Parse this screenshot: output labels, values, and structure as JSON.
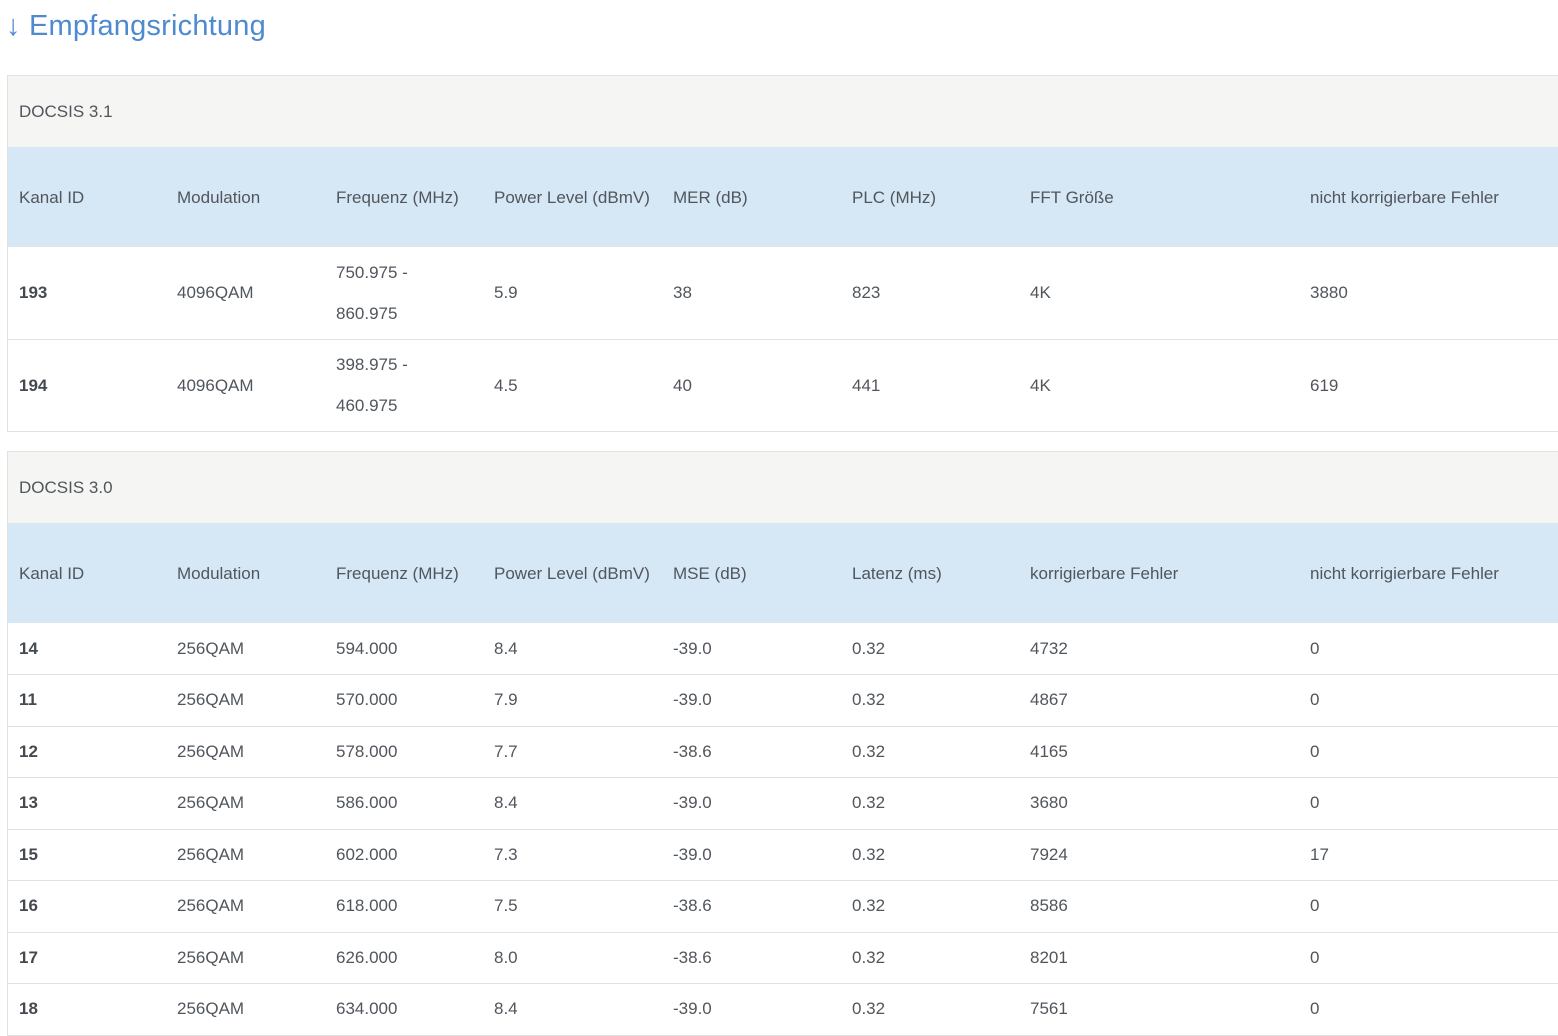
{
  "heading": "↓ Empfangsrichtung",
  "docsis31": {
    "title": "DOCSIS 3.1",
    "headers": [
      "Kanal ID",
      "Modulation",
      "Frequenz (MHz)",
      "Power Level (dBmV)",
      "MER (dB)",
      "PLC (MHz)",
      "FFT Größe",
      "nicht korrigierbare Fehler"
    ],
    "rows": [
      [
        "193",
        "4096QAM",
        "750.975 - 860.975",
        "5.9",
        "38",
        "823",
        "4K",
        "3880"
      ],
      [
        "194",
        "4096QAM",
        "398.975 - 460.975",
        "4.5",
        "40",
        "441",
        "4K",
        "619"
      ]
    ]
  },
  "docsis30": {
    "title": "DOCSIS 3.0",
    "headers": [
      "Kanal ID",
      "Modulation",
      "Frequenz (MHz)",
      "Power Level (dBmV)",
      "MSE (dB)",
      "Latenz (ms)",
      "korrigierbare Fehler",
      "nicht korrigierbare Fehler"
    ],
    "rows": [
      [
        "14",
        "256QAM",
        "594.000",
        "8.4",
        "-39.0",
        "0.32",
        "4732",
        "0"
      ],
      [
        "11",
        "256QAM",
        "570.000",
        "7.9",
        "-39.0",
        "0.32",
        "4867",
        "0"
      ],
      [
        "12",
        "256QAM",
        "578.000",
        "7.7",
        "-38.6",
        "0.32",
        "4165",
        "0"
      ],
      [
        "13",
        "256QAM",
        "586.000",
        "8.4",
        "-39.0",
        "0.32",
        "3680",
        "0"
      ],
      [
        "15",
        "256QAM",
        "602.000",
        "7.3",
        "-39.0",
        "0.32",
        "7924",
        "17"
      ],
      [
        "16",
        "256QAM",
        "618.000",
        "7.5",
        "-38.6",
        "0.32",
        "8586",
        "0"
      ],
      [
        "17",
        "256QAM",
        "626.000",
        "8.0",
        "-38.6",
        "0.32",
        "8201",
        "0"
      ],
      [
        "18",
        "256QAM",
        "634.000",
        "8.4",
        "-39.0",
        "0.32",
        "7561",
        "0"
      ]
    ]
  }
}
